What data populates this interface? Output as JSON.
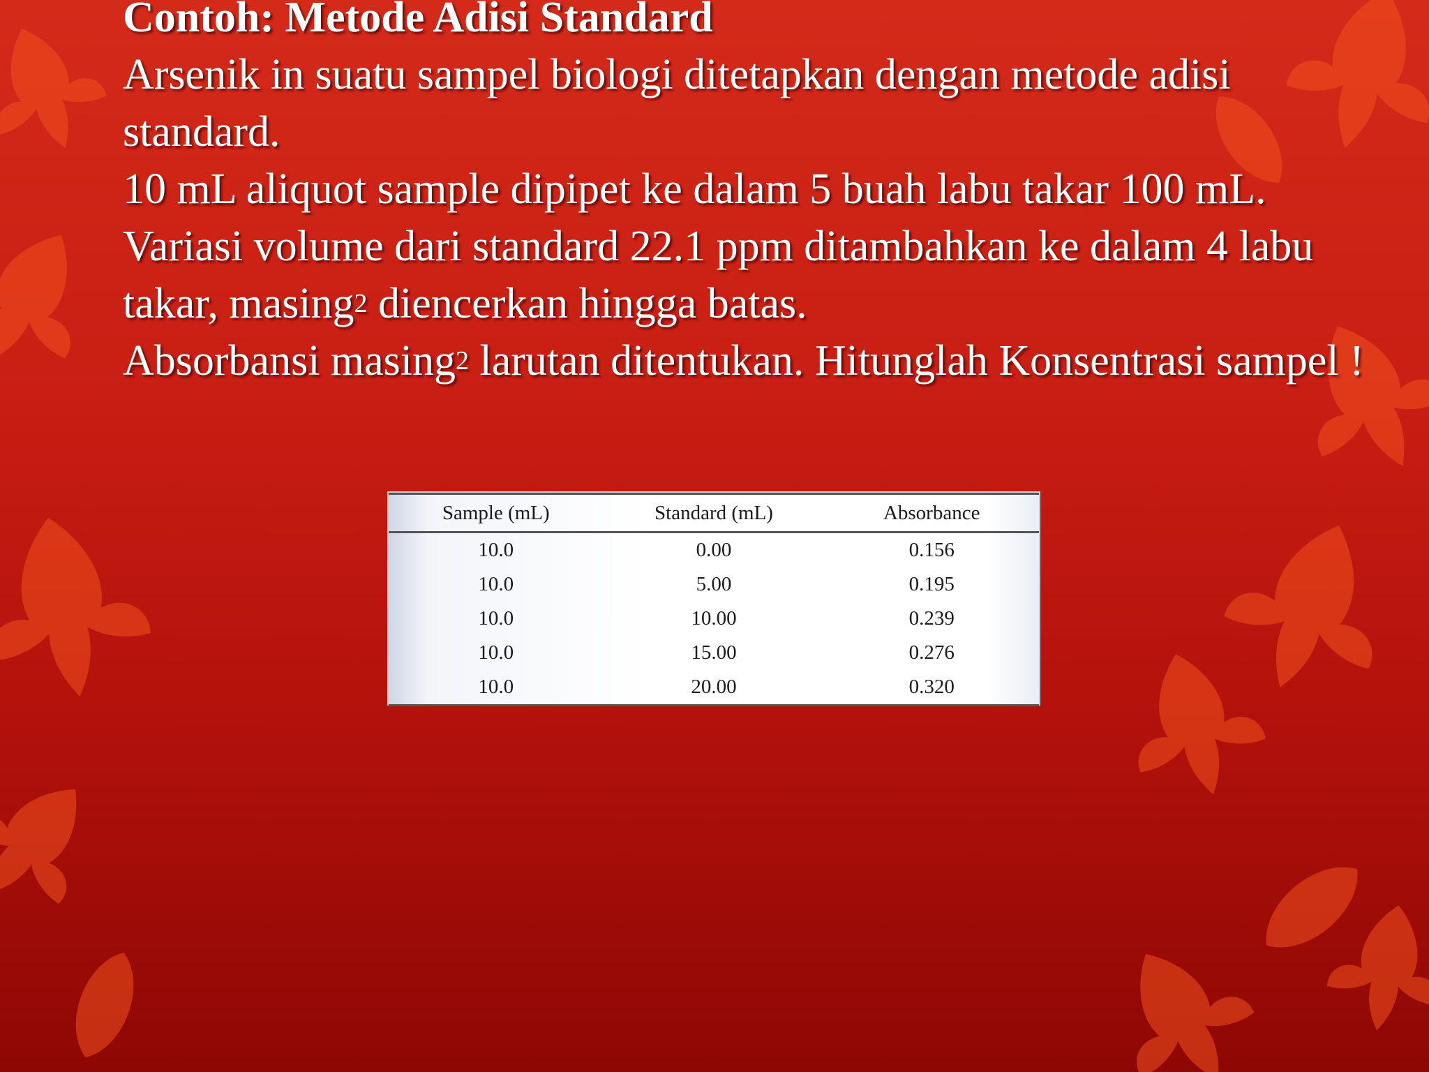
{
  "slide": {
    "title": "Contoh:  Metode Adisi Standard",
    "para1": "Arsenik in suatu sampel biologi ditetapkan dengan metode adisi standard.",
    "para2_a": "10 mL aliquot sample dipipet ke dalam 5 buah labu takar 100 mL. Variasi volume dari standard 22.1 ppm ditambahkan ke dalam 4 labu takar, masing",
    "para2_sup": "2",
    "para2_b": " diencerkan hingga batas.",
    "para3_a": "Absorbansi masing",
    "para3_sup": "2",
    "para3_b": " larutan ditentukan. Hitunglah Konsentrasi sampel !"
  },
  "table": {
    "headers": [
      "Sample (mL)",
      "Standard (mL)",
      "Absorbance"
    ],
    "rows": [
      [
        "10.0",
        "0.00",
        "0.156"
      ],
      [
        "10.0",
        "5.00",
        "0.195"
      ],
      [
        "10.0",
        "10.00",
        "0.239"
      ],
      [
        "10.0",
        "15.00",
        "0.276"
      ],
      [
        "10.0",
        "20.00",
        "0.320"
      ]
    ]
  },
  "colors": {
    "background_top": "#d42a1a",
    "background_bottom": "#8e0704",
    "leaf": "#f0501e",
    "text": "#ffffff"
  }
}
